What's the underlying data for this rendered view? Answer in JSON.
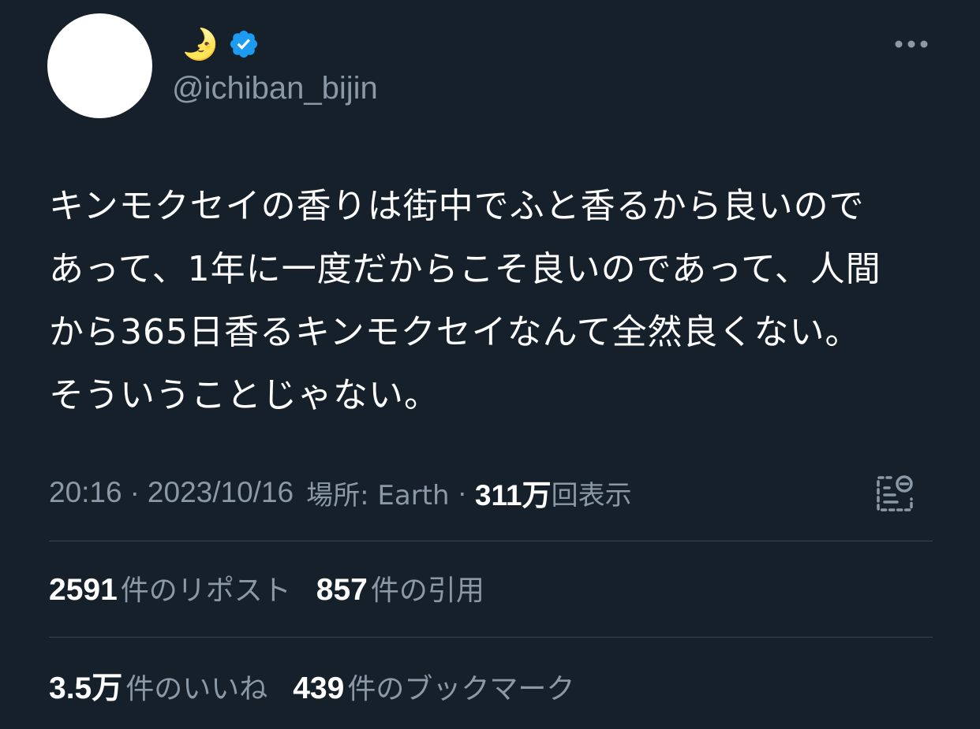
{
  "header": {
    "display_name": "🌛",
    "handle": "@ichiban_bijin",
    "verified": true,
    "more_icon": "more-dots-icon"
  },
  "tweet": {
    "text": "キンモクセイの香りは街中でふと香るから良いので\nあって、1年に一度だからこそ良いのであって、人間\nから365日香るキンモクセイなんて全然良くない。\nそういうことじゃない。"
  },
  "meta": {
    "time": "20:16",
    "separator": "·",
    "date": "2023/10/16",
    "location": "場所: Earth",
    "views_count": "311万",
    "views_label": "回表示",
    "analytics_icon": "analytics-icon"
  },
  "stats": {
    "reposts": {
      "count": "2591",
      "label": "件のリポスト"
    },
    "quotes": {
      "count": "857",
      "label": "件の引用"
    },
    "likes": {
      "count": "3.5万",
      "label": "件のいいね"
    },
    "bookmarks": {
      "count": "439",
      "label": "件のブックマーク"
    }
  },
  "colors": {
    "background": "#15202b",
    "text_primary": "#ffffff",
    "text_secondary": "#8b98a5",
    "divider": "#38444d",
    "verified_badge": "#1d9bf0"
  }
}
